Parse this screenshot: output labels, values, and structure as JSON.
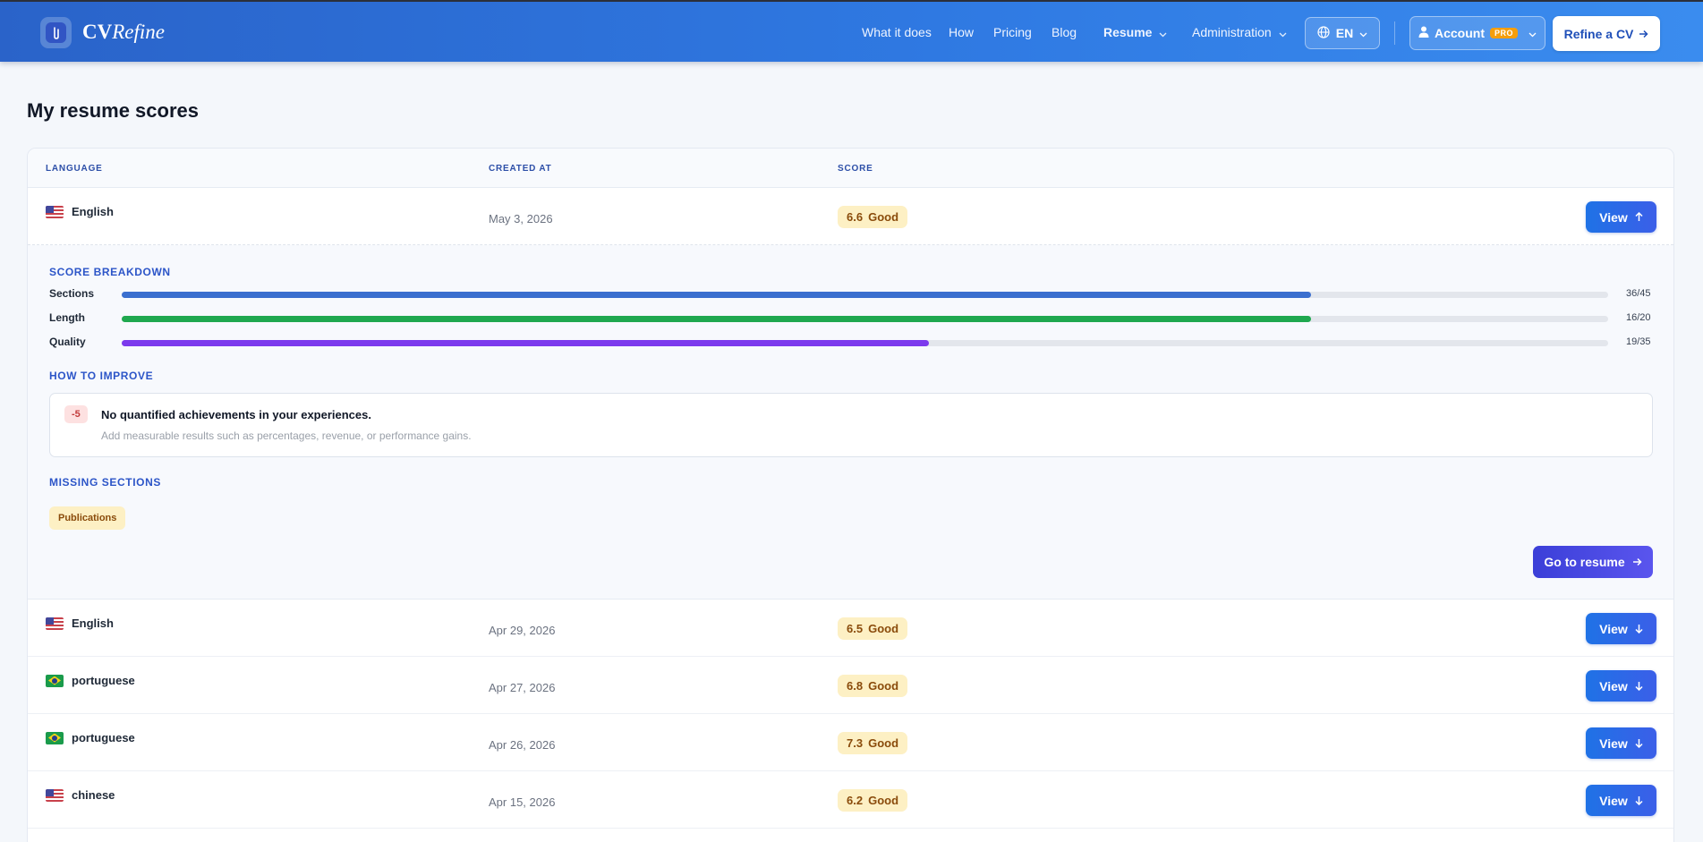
{
  "brand": {
    "name_bold": "CV",
    "name_italic": "Refine"
  },
  "nav": {
    "what_it_does": "What it does",
    "how": "How",
    "pricing": "Pricing",
    "blog": "Blog",
    "resume": "Resume",
    "administration": "Administration",
    "language": "EN",
    "account": "Account",
    "pro_badge": "PRO",
    "refine_cta": "Refine a CV"
  },
  "page": {
    "title": "My resume scores"
  },
  "table": {
    "headers": {
      "language": "LANGUAGE",
      "created_at": "CREATED AT",
      "score": "SCORE"
    },
    "rows": [
      {
        "language": "English",
        "flag": "us",
        "created_at": "May 3, 2026",
        "score": "6.6",
        "rating": "Good",
        "action": "View",
        "expanded": true
      },
      {
        "language": "English",
        "flag": "us",
        "created_at": "Apr 29, 2026",
        "score": "6.5",
        "rating": "Good",
        "action": "View"
      },
      {
        "language": "portuguese",
        "flag": "br",
        "created_at": "Apr 27, 2026",
        "score": "6.8",
        "rating": "Good",
        "action": "View"
      },
      {
        "language": "portuguese",
        "flag": "br",
        "created_at": "Apr 26, 2026",
        "score": "7.3",
        "rating": "Good",
        "action": "View"
      },
      {
        "language": "chinese",
        "flag": "us",
        "created_at": "Apr 15, 2026",
        "score": "6.2",
        "rating": "Good",
        "action": "View"
      }
    ]
  },
  "breakdown": {
    "title": "SCORE BREAKDOWN",
    "items": [
      {
        "label": "Sections",
        "value": "36/45",
        "fraction": 0.8,
        "color": "#3b6fcf"
      },
      {
        "label": "Length",
        "value": "16/20",
        "fraction": 0.8,
        "color": "#1fa84f"
      },
      {
        "label": "Quality",
        "value": "19/35",
        "fraction": 0.543,
        "color": "#7c3aed"
      }
    ]
  },
  "improve": {
    "title": "HOW TO IMPROVE",
    "penalty": "-5",
    "heading": "No quantified achievements in your experiences.",
    "description": "Add measurable results such as percentages, revenue, or performance gains."
  },
  "missing": {
    "title": "MISSING SECTIONS",
    "tag": "Publications"
  },
  "goto_button": "Go to resume",
  "colors": {
    "nav_start": "#2a63c9",
    "nav_end": "#3a8cef",
    "badge_bg": "#fdf0c4",
    "accent": "#2c55c8"
  }
}
